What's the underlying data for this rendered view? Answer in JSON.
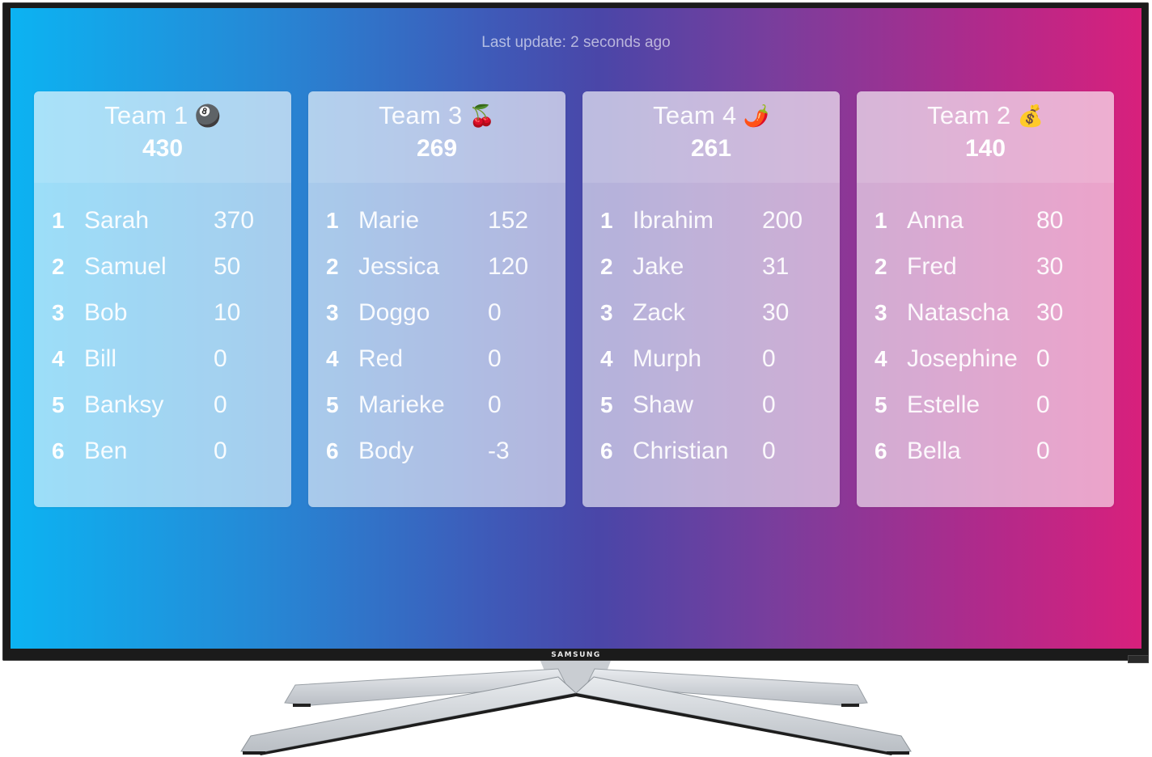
{
  "status": {
    "last_update": "Last update: 2 seconds ago"
  },
  "tv": {
    "brand": "SAMSUNG"
  },
  "colors": {
    "gradient_start": "#0cb3f2",
    "gradient_mid": "#4a46a8",
    "gradient_end": "#d8207c"
  },
  "teams": [
    {
      "name": "Team 1",
      "emoji": "🎱",
      "emoji_name": "billiard-8-ball-icon",
      "total": "430",
      "players": [
        {
          "rank": "1",
          "name": "Sarah",
          "score": "370"
        },
        {
          "rank": "2",
          "name": "Samuel",
          "score": "50"
        },
        {
          "rank": "3",
          "name": "Bob",
          "score": "10"
        },
        {
          "rank": "4",
          "name": "Bill",
          "score": "0"
        },
        {
          "rank": "5",
          "name": "Banksy",
          "score": "0"
        },
        {
          "rank": "6",
          "name": "Ben",
          "score": "0"
        }
      ]
    },
    {
      "name": "Team 3",
      "emoji": "🍒",
      "emoji_name": "cherries-icon",
      "total": "269",
      "players": [
        {
          "rank": "1",
          "name": "Marie",
          "score": "152"
        },
        {
          "rank": "2",
          "name": "Jessica",
          "score": "120"
        },
        {
          "rank": "3",
          "name": "Doggo",
          "score": "0"
        },
        {
          "rank": "4",
          "name": "Red",
          "score": "0"
        },
        {
          "rank": "5",
          "name": "Marieke",
          "score": "0"
        },
        {
          "rank": "6",
          "name": "Body",
          "score": "-3"
        }
      ]
    },
    {
      "name": "Team 4",
      "emoji": "🌶️",
      "emoji_name": "chili-pepper-icon",
      "total": "261",
      "players": [
        {
          "rank": "1",
          "name": "Ibrahim",
          "score": "200"
        },
        {
          "rank": "2",
          "name": "Jake",
          "score": "31"
        },
        {
          "rank": "3",
          "name": "Zack",
          "score": "30"
        },
        {
          "rank": "4",
          "name": "Murph",
          "score": "0"
        },
        {
          "rank": "5",
          "name": "Shaw",
          "score": "0"
        },
        {
          "rank": "6",
          "name": "Christian",
          "score": "0"
        }
      ]
    },
    {
      "name": "Team 2",
      "emoji": "💰",
      "emoji_name": "money-bag-icon",
      "total": "140",
      "players": [
        {
          "rank": "1",
          "name": "Anna",
          "score": "80"
        },
        {
          "rank": "2",
          "name": "Fred",
          "score": "30"
        },
        {
          "rank": "3",
          "name": "Natascha",
          "score": "30"
        },
        {
          "rank": "4",
          "name": "Josephine",
          "score": "0"
        },
        {
          "rank": "5",
          "name": "Estelle",
          "score": "0"
        },
        {
          "rank": "6",
          "name": "Bella",
          "score": "0"
        }
      ]
    }
  ]
}
